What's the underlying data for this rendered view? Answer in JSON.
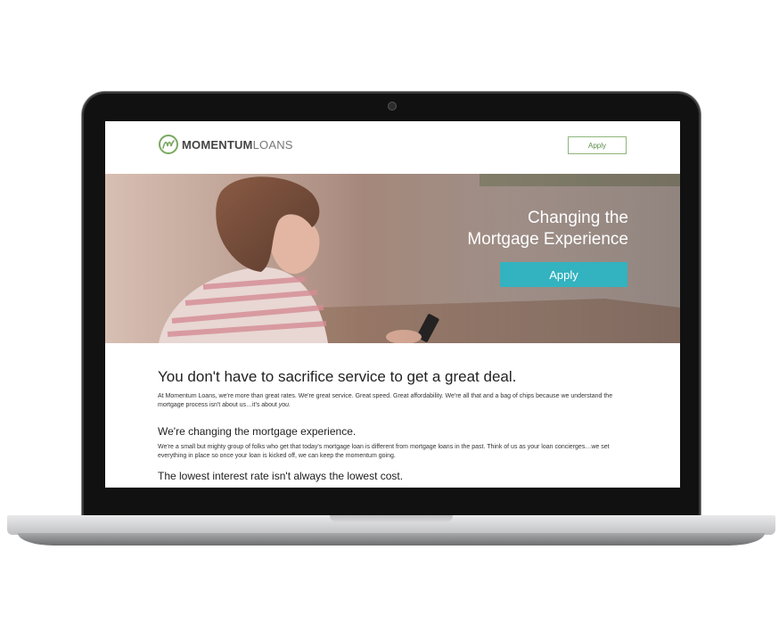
{
  "nav": {
    "logo_bold": "MOMENTUM",
    "logo_light": "LOANS",
    "apply_label": "Apply"
  },
  "hero": {
    "title_line1": "Changing the",
    "title_line2": "Mortgage Experience",
    "apply_label": "Apply"
  },
  "content": {
    "heading1": "You don't have to sacrifice service to get a great deal.",
    "para1": "At Momentum Loans, we're more than great rates. We're great service. Great speed. Great affordability. We're all that and a bag of chips because we understand the mortgage process isn't about us…it's about ",
    "para1_emph": "you.",
    "heading2": "We're changing the mortgage experience.",
    "para2": "We're a small but mighty group of folks who get that today's mortgage loan is different from mortgage loans in the past. Think of us as your loan concierges…we set everything in place so once your loan is kicked off, we can keep the momentum going.",
    "heading3": "The lowest interest rate isn't always the lowest cost."
  },
  "icons": {
    "logo": "momentum-m-circle-icon",
    "camera": "webcam-icon"
  },
  "colors": {
    "brand_green": "#7aa860",
    "accent_teal": "#33b2bf"
  }
}
